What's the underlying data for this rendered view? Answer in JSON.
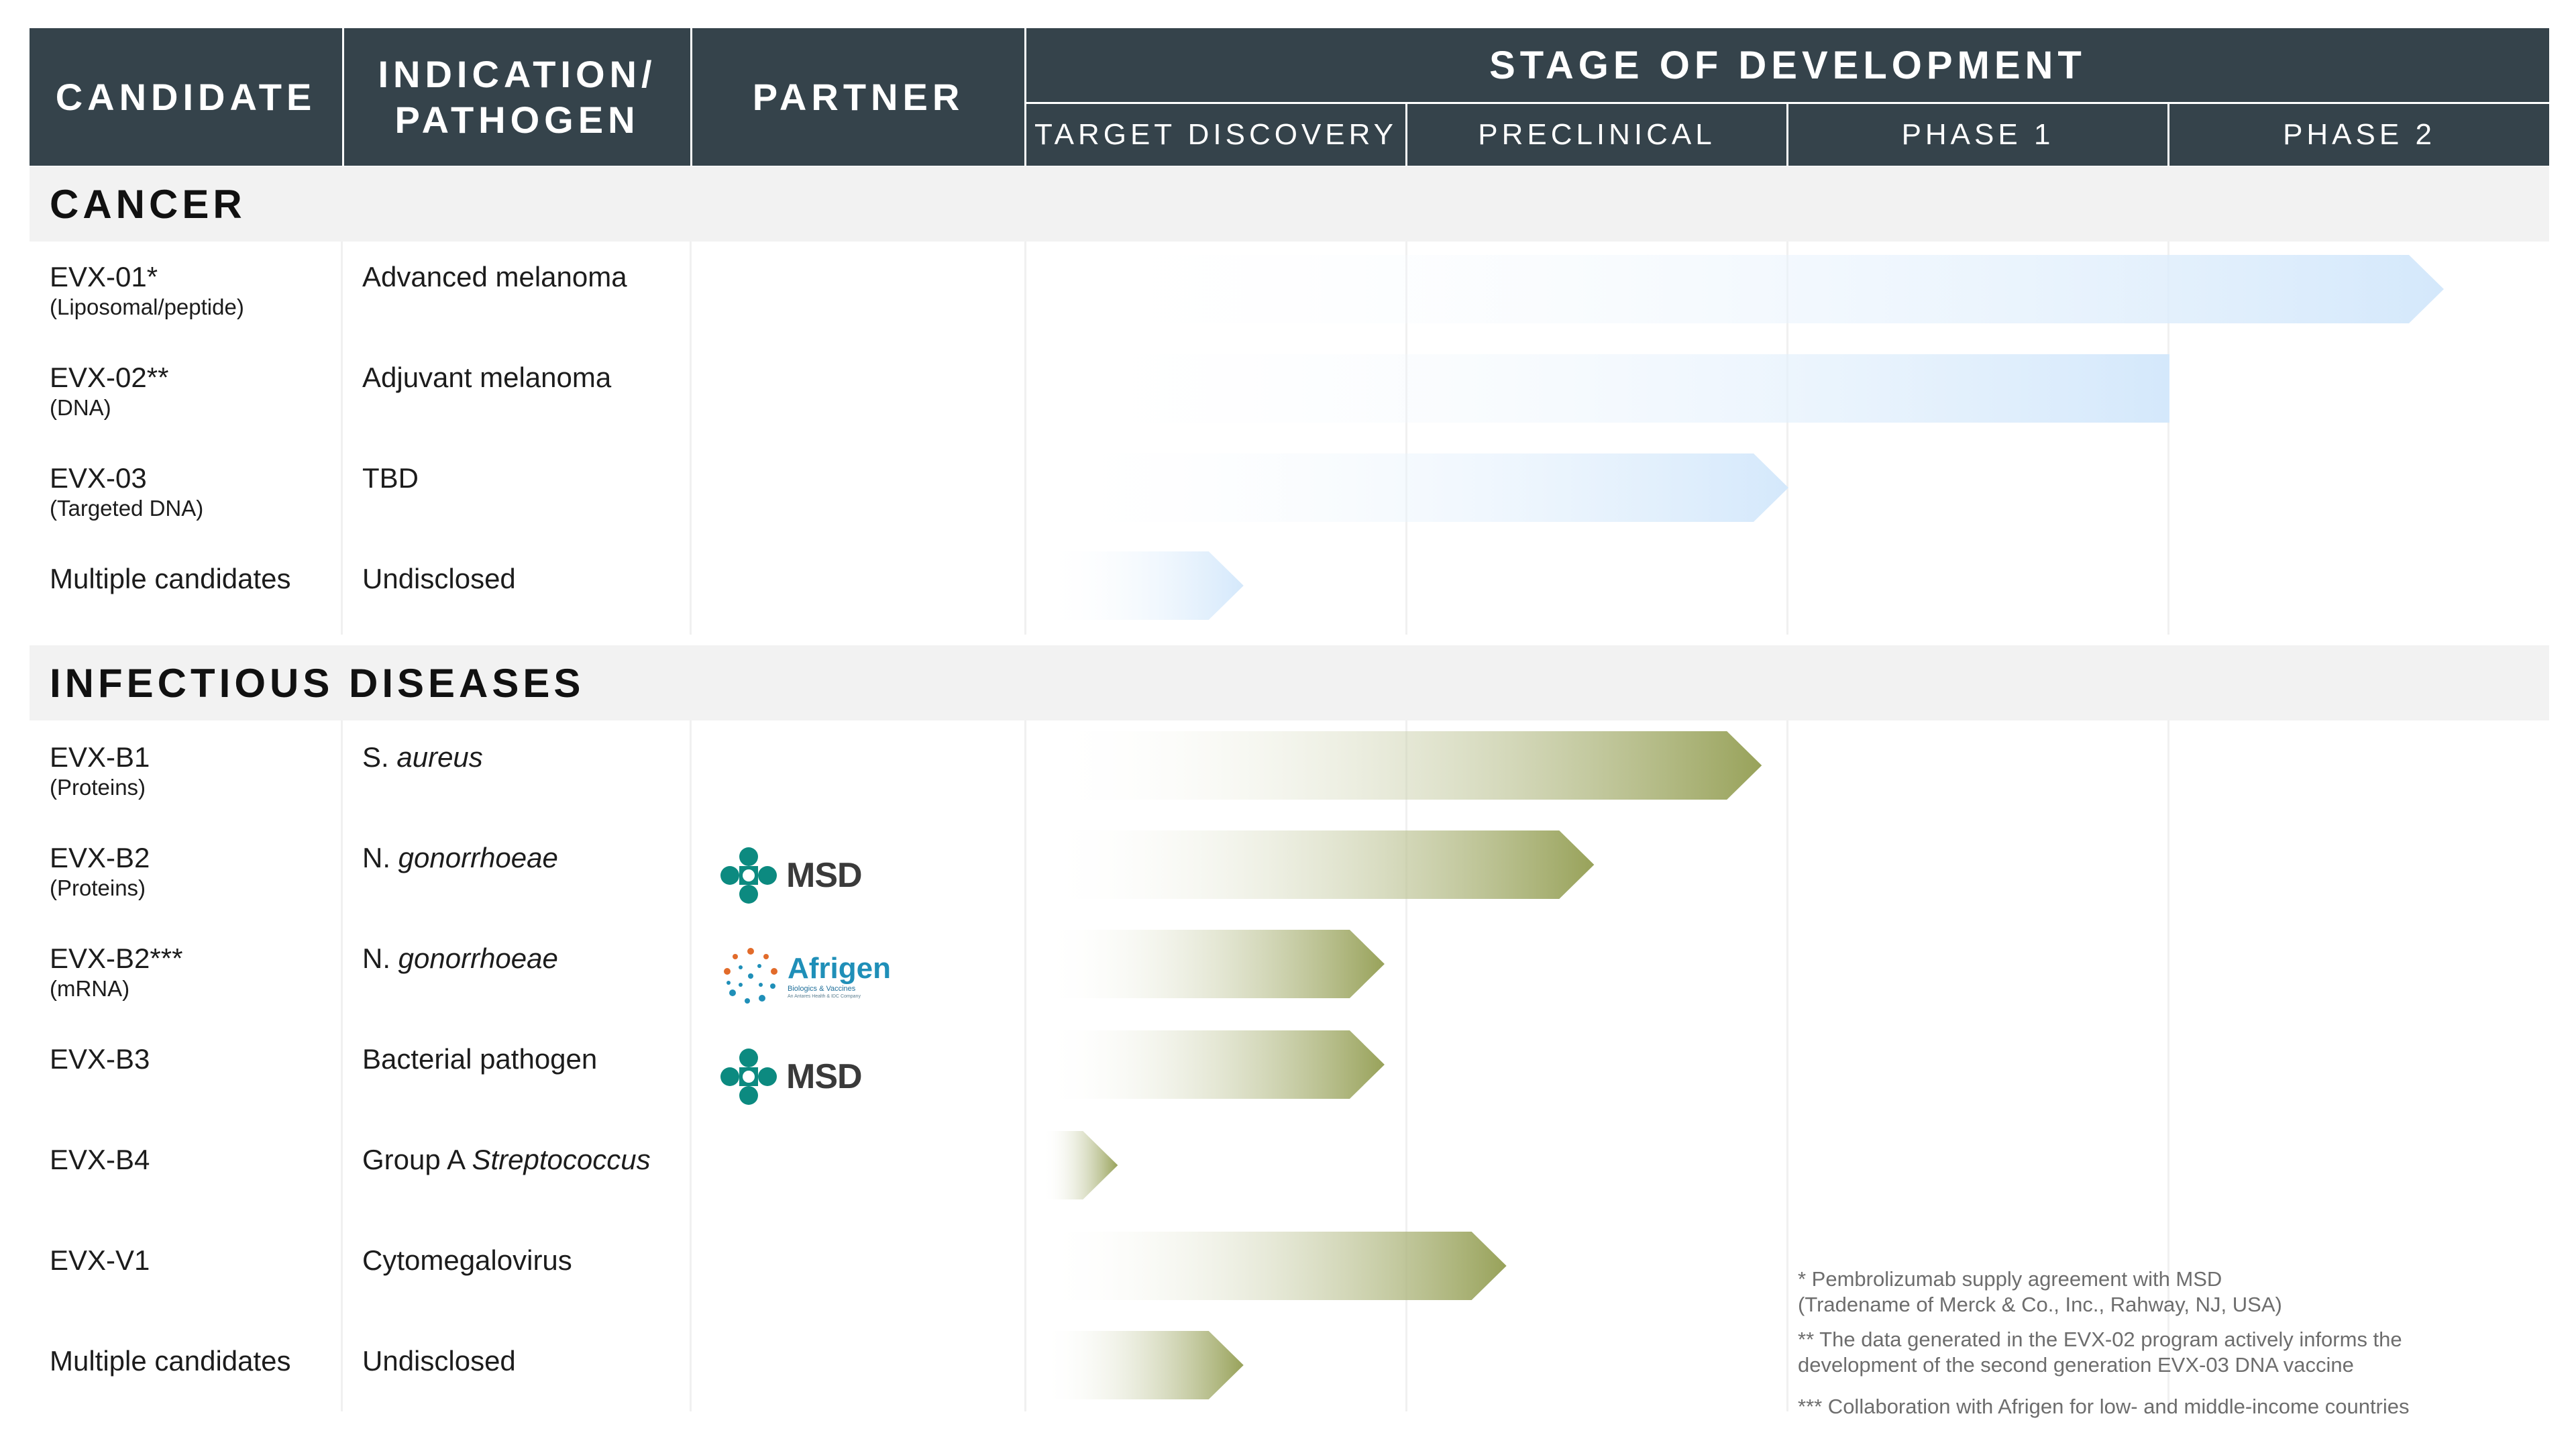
{
  "header": {
    "candidate": "CANDIDATE",
    "indication": "INDICATION/\nPATHOGEN",
    "partner": "PARTNER",
    "stage": "STAGE OF DEVELOPMENT",
    "phases": [
      "TARGET DISCOVERY",
      "PRECLINICAL",
      "PHASE 1",
      "PHASE 2"
    ]
  },
  "sections": [
    {
      "title": "CANCER",
      "bar_color": "#d4e8fb",
      "rows": [
        {
          "name": "EVX-01*",
          "sub": "(Liposomal/peptide)",
          "indication": "Advanced melanoma",
          "partner": "",
          "stage_end": 3.72,
          "shape": "arrow"
        },
        {
          "name": "EVX-02**",
          "sub": "(DNA)",
          "indication": "Adjuvant melanoma",
          "partner": "",
          "stage_end": 3.0,
          "shape": "flat"
        },
        {
          "name": "EVX-03",
          "sub": "(Targeted DNA)",
          "indication": "TBD",
          "partner": "",
          "stage_end": 2.0,
          "shape": "arrow"
        },
        {
          "name": "Multiple candidates",
          "sub": "",
          "indication": "Undisclosed",
          "partner": "",
          "stage_end": 0.57,
          "shape": "arrow"
        }
      ]
    },
    {
      "title": "INFECTIOUS DISEASES",
      "bar_color": "#98a25a",
      "rows": [
        {
          "name": "EVX-B1",
          "sub": "(Proteins)",
          "indication": "S. ",
          "indication_italic": "aureus",
          "partner": "",
          "stage_end": 1.93,
          "shape": "arrow"
        },
        {
          "name": "EVX-B2",
          "sub": "(Proteins)",
          "indication": "N. ",
          "indication_italic": "gonorrhoeae",
          "partner": "MSD",
          "stage_end": 1.49,
          "shape": "arrow"
        },
        {
          "name": "EVX-B2***",
          "sub": "(mRNA)",
          "indication": "N. ",
          "indication_italic": "gonorrhoeae",
          "partner": "Afrigen",
          "stage_end": 0.94,
          "shape": "arrow"
        },
        {
          "name": "EVX-B3",
          "sub": "",
          "indication": "Bacterial pathogen",
          "partner": "MSD",
          "stage_end": 0.94,
          "shape": "arrow"
        },
        {
          "name": "EVX-B4",
          "sub": "",
          "indication": "Group A ",
          "indication_italic": "Streptococcus",
          "partner": "",
          "stage_end": 0.24,
          "shape": "arrow"
        },
        {
          "name": "EVX-V1",
          "sub": "",
          "indication": "Cytomegalovirus",
          "partner": "",
          "stage_end": 1.26,
          "shape": "arrow"
        },
        {
          "name": "Multiple candidates",
          "sub": "",
          "indication": "Undisclosed",
          "partner": "",
          "stage_end": 0.57,
          "shape": "arrow"
        }
      ]
    }
  ],
  "partners": {
    "msd": {
      "label": "MSD",
      "color": "#0c8a80"
    },
    "afrigen": {
      "title": "Afrigen",
      "sub": "Biologics & Vaccines",
      "sub2": "An Antares Health & IDC Company"
    }
  },
  "footnotes": [
    "* Pembrolizumab supply agreement with MSD\n(Tradename of Merck & Co., Inc., Rahway, NJ, USA)",
    "** The data generated in the EVX-02 program actively informs  the\ndevelopment of the second generation EVX-03 DNA vaccine",
    "*** Collaboration with Afrigen for low- and middle-income countries"
  ],
  "chart_data": {
    "type": "bar",
    "orientation": "horizontal",
    "x_scale": [
      "TARGET DISCOVERY",
      "PRECLINICAL",
      "PHASE 1",
      "PHASE 2"
    ],
    "xlim": [
      0,
      4
    ],
    "series": [
      {
        "name": "CANCER",
        "categories": [
          "EVX-01*",
          "EVX-02**",
          "EVX-03",
          "Multiple candidates"
        ],
        "values": [
          3.72,
          3.0,
          2.0,
          0.57
        ]
      },
      {
        "name": "INFECTIOUS DISEASES",
        "categories": [
          "EVX-B1",
          "EVX-B2",
          "EVX-B2***",
          "EVX-B3",
          "EVX-B4",
          "EVX-V1",
          "Multiple candidates"
        ],
        "values": [
          1.93,
          1.49,
          0.94,
          0.94,
          0.24,
          1.26,
          0.57
        ]
      }
    ],
    "colors": {
      "cancer": "#d4e8fb",
      "infectious": "#98a25a"
    }
  }
}
